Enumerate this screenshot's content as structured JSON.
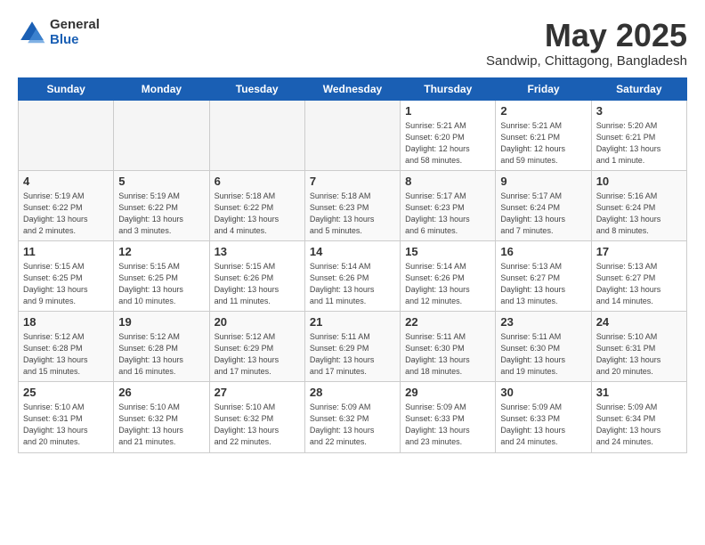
{
  "logo": {
    "general": "General",
    "blue": "Blue"
  },
  "title": "May 2025",
  "subtitle": "Sandwip, Chittagong, Bangladesh",
  "days_of_week": [
    "Sunday",
    "Monday",
    "Tuesday",
    "Wednesday",
    "Thursday",
    "Friday",
    "Saturday"
  ],
  "weeks": [
    {
      "days": [
        {
          "number": "",
          "info": ""
        },
        {
          "number": "",
          "info": ""
        },
        {
          "number": "",
          "info": ""
        },
        {
          "number": "",
          "info": ""
        },
        {
          "number": "1",
          "info": "Sunrise: 5:21 AM\nSunset: 6:20 PM\nDaylight: 12 hours\nand 58 minutes."
        },
        {
          "number": "2",
          "info": "Sunrise: 5:21 AM\nSunset: 6:21 PM\nDaylight: 12 hours\nand 59 minutes."
        },
        {
          "number": "3",
          "info": "Sunrise: 5:20 AM\nSunset: 6:21 PM\nDaylight: 13 hours\nand 1 minute."
        }
      ]
    },
    {
      "days": [
        {
          "number": "4",
          "info": "Sunrise: 5:19 AM\nSunset: 6:22 PM\nDaylight: 13 hours\nand 2 minutes."
        },
        {
          "number": "5",
          "info": "Sunrise: 5:19 AM\nSunset: 6:22 PM\nDaylight: 13 hours\nand 3 minutes."
        },
        {
          "number": "6",
          "info": "Sunrise: 5:18 AM\nSunset: 6:22 PM\nDaylight: 13 hours\nand 4 minutes."
        },
        {
          "number": "7",
          "info": "Sunrise: 5:18 AM\nSunset: 6:23 PM\nDaylight: 13 hours\nand 5 minutes."
        },
        {
          "number": "8",
          "info": "Sunrise: 5:17 AM\nSunset: 6:23 PM\nDaylight: 13 hours\nand 6 minutes."
        },
        {
          "number": "9",
          "info": "Sunrise: 5:17 AM\nSunset: 6:24 PM\nDaylight: 13 hours\nand 7 minutes."
        },
        {
          "number": "10",
          "info": "Sunrise: 5:16 AM\nSunset: 6:24 PM\nDaylight: 13 hours\nand 8 minutes."
        }
      ]
    },
    {
      "days": [
        {
          "number": "11",
          "info": "Sunrise: 5:15 AM\nSunset: 6:25 PM\nDaylight: 13 hours\nand 9 minutes."
        },
        {
          "number": "12",
          "info": "Sunrise: 5:15 AM\nSunset: 6:25 PM\nDaylight: 13 hours\nand 10 minutes."
        },
        {
          "number": "13",
          "info": "Sunrise: 5:15 AM\nSunset: 6:26 PM\nDaylight: 13 hours\nand 11 minutes."
        },
        {
          "number": "14",
          "info": "Sunrise: 5:14 AM\nSunset: 6:26 PM\nDaylight: 13 hours\nand 11 minutes."
        },
        {
          "number": "15",
          "info": "Sunrise: 5:14 AM\nSunset: 6:26 PM\nDaylight: 13 hours\nand 12 minutes."
        },
        {
          "number": "16",
          "info": "Sunrise: 5:13 AM\nSunset: 6:27 PM\nDaylight: 13 hours\nand 13 minutes."
        },
        {
          "number": "17",
          "info": "Sunrise: 5:13 AM\nSunset: 6:27 PM\nDaylight: 13 hours\nand 14 minutes."
        }
      ]
    },
    {
      "days": [
        {
          "number": "18",
          "info": "Sunrise: 5:12 AM\nSunset: 6:28 PM\nDaylight: 13 hours\nand 15 minutes."
        },
        {
          "number": "19",
          "info": "Sunrise: 5:12 AM\nSunset: 6:28 PM\nDaylight: 13 hours\nand 16 minutes."
        },
        {
          "number": "20",
          "info": "Sunrise: 5:12 AM\nSunset: 6:29 PM\nDaylight: 13 hours\nand 17 minutes."
        },
        {
          "number": "21",
          "info": "Sunrise: 5:11 AM\nSunset: 6:29 PM\nDaylight: 13 hours\nand 17 minutes."
        },
        {
          "number": "22",
          "info": "Sunrise: 5:11 AM\nSunset: 6:30 PM\nDaylight: 13 hours\nand 18 minutes."
        },
        {
          "number": "23",
          "info": "Sunrise: 5:11 AM\nSunset: 6:30 PM\nDaylight: 13 hours\nand 19 minutes."
        },
        {
          "number": "24",
          "info": "Sunrise: 5:10 AM\nSunset: 6:31 PM\nDaylight: 13 hours\nand 20 minutes."
        }
      ]
    },
    {
      "days": [
        {
          "number": "25",
          "info": "Sunrise: 5:10 AM\nSunset: 6:31 PM\nDaylight: 13 hours\nand 20 minutes."
        },
        {
          "number": "26",
          "info": "Sunrise: 5:10 AM\nSunset: 6:32 PM\nDaylight: 13 hours\nand 21 minutes."
        },
        {
          "number": "27",
          "info": "Sunrise: 5:10 AM\nSunset: 6:32 PM\nDaylight: 13 hours\nand 22 minutes."
        },
        {
          "number": "28",
          "info": "Sunrise: 5:09 AM\nSunset: 6:32 PM\nDaylight: 13 hours\nand 22 minutes."
        },
        {
          "number": "29",
          "info": "Sunrise: 5:09 AM\nSunset: 6:33 PM\nDaylight: 13 hours\nand 23 minutes."
        },
        {
          "number": "30",
          "info": "Sunrise: 5:09 AM\nSunset: 6:33 PM\nDaylight: 13 hours\nand 24 minutes."
        },
        {
          "number": "31",
          "info": "Sunrise: 5:09 AM\nSunset: 6:34 PM\nDaylight: 13 hours\nand 24 minutes."
        }
      ]
    }
  ]
}
